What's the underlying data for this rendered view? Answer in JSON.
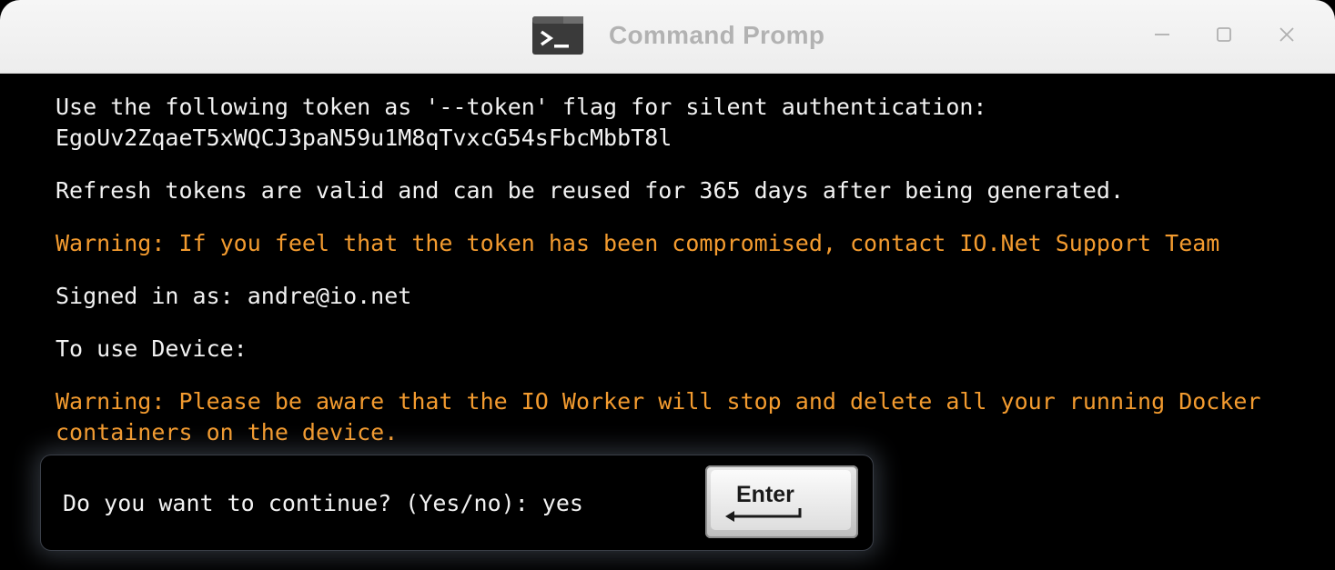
{
  "window": {
    "title": "Command Promp",
    "icon": "terminal-icon",
    "controls": [
      "minimize-icon",
      "maximize-icon",
      "close-icon"
    ]
  },
  "terminal": {
    "token_line": "Use the following token as '--token' flag for silent authentication:",
    "token_value": "EgoUv2ZqaeT5xWQCJ3paN59u1M8qTvxcG54sFbcMbbT8l",
    "refresh_line": "Refresh tokens are valid and can be reused for 365 days after being generated.",
    "warning_compromised": "Warning: If you feel that the token has been compromised, contact IO.Net Support Team",
    "signed_in": "Signed in as: andre@io.net",
    "use_device": "To use Device:",
    "warning_docker_line1": "Warning: Please be aware that the IO Worker will stop and delete all your running Docker",
    "warning_docker_line2": "containers on the device."
  },
  "prompt": {
    "question": "Do you want to continue? (Yes/no): yes",
    "enter_key_label": "Enter"
  },
  "colors": {
    "background": "#000000",
    "text": "#f2f2f2",
    "warning": "#f39b2f",
    "titlebar": "#f2f2f2",
    "title_text": "#b2b2b2"
  }
}
